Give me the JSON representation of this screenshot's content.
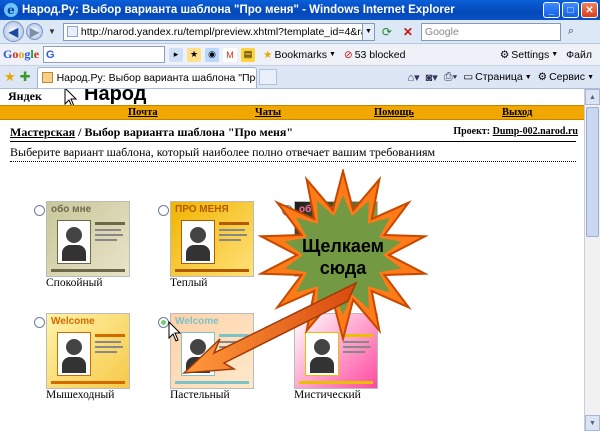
{
  "window": {
    "title": "Народ.Ру: Выбор варианта шаблона \"Про меня\" - Windows Internet Explorer",
    "buttons": {
      "minimize": "_",
      "maximize": "□",
      "close": "✕"
    }
  },
  "address_bar": {
    "url": "http://narod.yandex.ru/templ/preview.xhtml?template_id=4&random_nocach",
    "search_placeholder": "Google"
  },
  "google_toolbar": {
    "logo": [
      "G",
      "o",
      "o",
      "g",
      "l",
      "e"
    ],
    "search_value": "G",
    "bookmarks": "Bookmarks",
    "blocked": "53 blocked",
    "settings": "Settings",
    "file": "Файл"
  },
  "tab_bar": {
    "active_tab": "Народ.Ру: Выбор варианта шаблона \"Про меня\"",
    "page_menu": "Страница",
    "tools_menu": "Сервис"
  },
  "page": {
    "logo_word": "Яндек",
    "logo_big": "Народ",
    "menu": [
      {
        "label": "Почта"
      },
      {
        "label": "Чаты"
      },
      {
        "label": "Помощь"
      },
      {
        "label": "Выход"
      }
    ],
    "breadcrumb_link": "Мастерская",
    "breadcrumb_sep": " / ",
    "breadcrumb_current": "Выбор варианта шаблона \"Про меня\"",
    "project_label": "Проект: ",
    "project_value": "Dump-002.narod.ru",
    "instruction": "Выберите вариант шаблона, который наиболее полно отвечает вашим требованиям",
    "templates": [
      {
        "label": "Спокойный",
        "thumb_text": "обо мне",
        "selected": false,
        "palette": [
          "#c9c79a",
          "#e9e3c8",
          "#6d6a4c"
        ]
      },
      {
        "label": "Теплый",
        "thumb_text": "ПРО МЕНЯ",
        "selected": false,
        "palette": [
          "#f0b400",
          "#ffe27a",
          "#b35a00"
        ]
      },
      {
        "label": "",
        "thumb_text": "обо мне",
        "selected": false,
        "palette": [
          "#1a1a1a",
          "#d0f050",
          "#ff6aa0"
        ]
      },
      {
        "label": "Мышеходный",
        "thumb_text": "Welcome",
        "selected": false,
        "palette": [
          "#fff3a8",
          "#f6c94a",
          "#d06b00"
        ]
      },
      {
        "label": "Пастельный",
        "thumb_text": "Welcome",
        "selected": true,
        "palette": [
          "#ffd2a8",
          "#ffe8cc",
          "#7cc3c8"
        ]
      },
      {
        "label": "Мистический",
        "thumb_text": "",
        "selected": false,
        "palette": [
          "#ffffff",
          "#ff4aa0",
          "#e7c000"
        ]
      }
    ],
    "callout": [
      "Щелкаем",
      "сюда"
    ],
    "colors": {
      "menu_bar": "#f0a800",
      "starburst": "#ff7a18",
      "starburst_inner": "#5aa04a",
      "arrow": "#e85a18"
    }
  }
}
